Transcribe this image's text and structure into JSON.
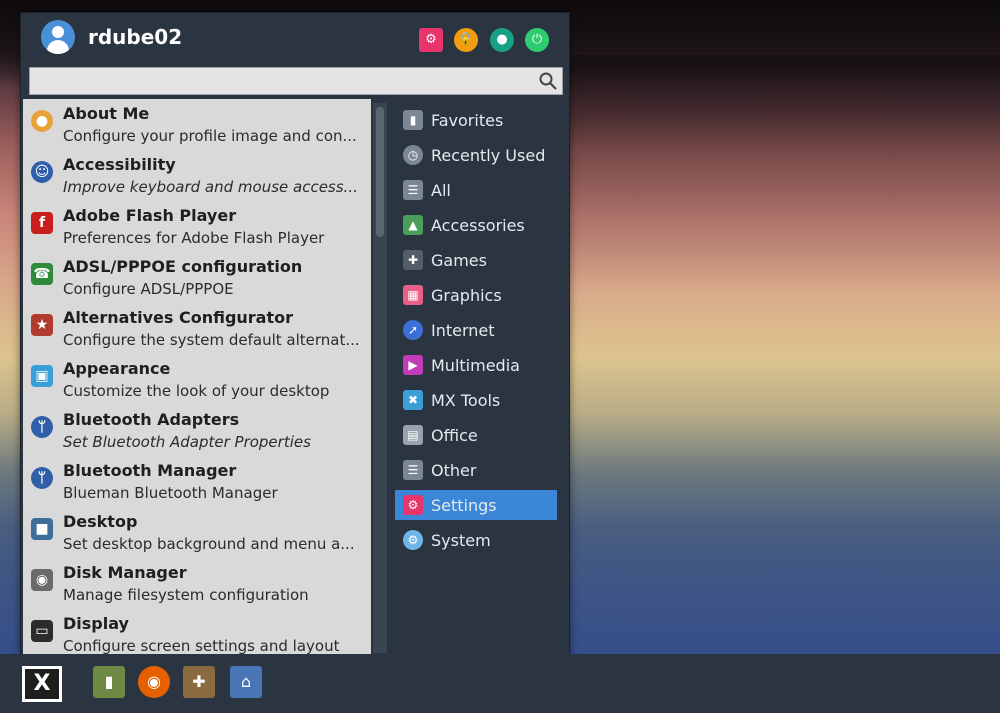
{
  "user": {
    "name": "rdube02",
    "avatar_icon": "user-avatar-icon"
  },
  "header_actions": [
    {
      "name": "settings-manager-button",
      "icon": "settings-icon",
      "color": "#e8336b"
    },
    {
      "name": "lock-screen-button",
      "icon": "lock-icon",
      "color": "#f39c12"
    },
    {
      "name": "switch-user-button",
      "icon": "user-icon",
      "color": "#16a085"
    },
    {
      "name": "log-out-button",
      "icon": "power-icon",
      "color": "#2ecc71"
    }
  ],
  "search": {
    "value": "",
    "placeholder": "",
    "icon": "search-icon"
  },
  "apps": [
    {
      "name": "About Me",
      "desc": "Configure your profile image and con...",
      "icon": "about-me-icon",
      "color": "#e8a23a"
    },
    {
      "name": "Accessibility",
      "desc": "Improve keyboard and mouse access...",
      "icon": "accessibility-icon",
      "color": "#2f5fa8",
      "italic": true
    },
    {
      "name": "Adobe Flash Player",
      "desc": "Preferences for Adobe Flash Player",
      "icon": "flash-icon",
      "color": "#c81e1e"
    },
    {
      "name": "ADSL/PPPOE configuration",
      "desc": "Configure ADSL/PPPOE",
      "icon": "phone-icon",
      "color": "#2e8b3c"
    },
    {
      "name": "Alternatives Configurator",
      "desc": "Configure the system default alternat...",
      "icon": "alternatives-icon",
      "color": "#b03a2e"
    },
    {
      "name": "Appearance",
      "desc": "Customize the look of your desktop",
      "icon": "appearance-icon",
      "color": "#3a9fd8"
    },
    {
      "name": "Bluetooth Adapters",
      "desc": "Set Bluetooth Adapter Properties",
      "icon": "bluetooth-icon",
      "color": "#2f5fa8",
      "italic": true
    },
    {
      "name": "Bluetooth Manager",
      "desc": "Blueman Bluetooth Manager",
      "icon": "bluetooth-icon",
      "color": "#2f5fa8"
    },
    {
      "name": "Desktop",
      "desc": "Set desktop background and menu a...",
      "icon": "desktop-icon",
      "color": "#3d6f99"
    },
    {
      "name": "Disk Manager",
      "desc": "Manage filesystem configuration",
      "icon": "disk-icon",
      "color": "#6a6a6a"
    },
    {
      "name": "Display",
      "desc": "Configure screen settings and layout",
      "icon": "display-icon",
      "color": "#2c2c2c"
    }
  ],
  "categories": [
    {
      "label": "Favorites",
      "icon": "bookmark-icon",
      "color": "#7b8794"
    },
    {
      "label": "Recently Used",
      "icon": "clock-icon",
      "color": "#7b8794"
    },
    {
      "label": "All",
      "icon": "list-icon",
      "color": "#7b8794"
    },
    {
      "label": "Accessories",
      "icon": "accessories-icon",
      "color": "#4a9d5b"
    },
    {
      "label": "Games",
      "icon": "gamepad-icon",
      "color": "#555d66"
    },
    {
      "label": "Graphics",
      "icon": "graphics-icon",
      "color": "#e8608a"
    },
    {
      "label": "Internet",
      "icon": "internet-icon",
      "color": "#3b6fd6"
    },
    {
      "label": "Multimedia",
      "icon": "multimedia-icon",
      "color": "#c23bb8"
    },
    {
      "label": "MX Tools",
      "icon": "mx-tools-icon",
      "color": "#3a9fd8"
    },
    {
      "label": "Office",
      "icon": "office-icon",
      "color": "#9aa3ad"
    },
    {
      "label": "Other",
      "icon": "other-icon",
      "color": "#7b8794"
    },
    {
      "label": "Settings",
      "icon": "settings-icon",
      "color": "#e8336b",
      "selected": true
    },
    {
      "label": "System",
      "icon": "system-icon",
      "color": "#6fb6e8"
    }
  ],
  "taskbar": [
    {
      "name": "mx-menu-button",
      "icon": "mx-logo-icon"
    },
    {
      "name": "terminal-launcher",
      "icon": "terminal-icon"
    },
    {
      "name": "firefox-launcher",
      "icon": "firefox-icon"
    },
    {
      "name": "package-installer-launcher",
      "icon": "package-installer-icon"
    },
    {
      "name": "file-manager-launcher",
      "icon": "home-folder-icon"
    }
  ]
}
